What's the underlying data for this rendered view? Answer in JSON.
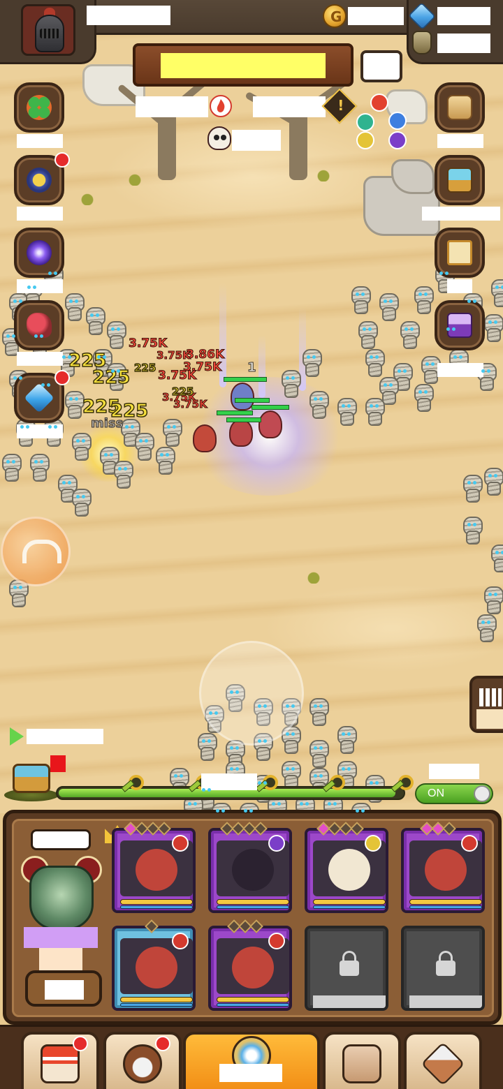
{
  "hud": {
    "auto_toggle_label": "ON"
  },
  "combat_numbers": {
    "red_hits": [
      "3.75K",
      "3.86K",
      "3.75K",
      "3.75K",
      "3.75K",
      "3.75K",
      "3.75K"
    ],
    "yellow_hits": [
      "225",
      "225",
      "225",
      "225",
      "225",
      "225"
    ],
    "miss_text": "miss",
    "counter_text": "1"
  },
  "icons": {
    "top_left": "player-avatar-knight",
    "resources": [
      "gold-coin-icon",
      "blue-gem-icon",
      "potion-jar-icon"
    ],
    "left_menu": [
      "clover-icon",
      "medal-icon",
      "portal-icon",
      "bouquet-icon",
      "diamond-icon"
    ],
    "right_menu": [
      "scroll-icon",
      "treasure-chest-icon",
      "quest-board-icon",
      "purple-chest-icon"
    ],
    "bottom_nav": [
      "shop-icon",
      "hero-icon",
      "battle-icon",
      "bag-icon",
      "forge-icon"
    ]
  },
  "heroes": [
    {
      "slot": 1,
      "frame": "purple",
      "element": "fire",
      "stars_on": 1,
      "stars_total": 4,
      "crown": true
    },
    {
      "slot": 2,
      "frame": "purple",
      "element": "dark",
      "stars_on": 0,
      "stars_total": 4
    },
    {
      "slot": 3,
      "frame": "purple",
      "element": "light",
      "stars_on": 1,
      "stars_total": 4
    },
    {
      "slot": 4,
      "frame": "purple",
      "element": "fire",
      "stars_on": 2,
      "stars_total": 3
    },
    {
      "slot": 5,
      "frame": "blue",
      "element": "fire",
      "stars_on": 0,
      "stars_total": 1
    },
    {
      "slot": 6,
      "frame": "purple",
      "element": "fire",
      "stars_on": 0,
      "stars_total": 3
    },
    {
      "slot": 7,
      "frame": "locked"
    },
    {
      "slot": 8,
      "frame": "locked"
    }
  ],
  "colors": {
    "frame_purple": "#9c48c9",
    "frame_blue": "#6fc1e0",
    "accent_orange": "#f28f16",
    "notification_red": "#e52b2b",
    "toggle_green": "#4aa021"
  },
  "stage_progress": {
    "fraction": 0.98
  }
}
